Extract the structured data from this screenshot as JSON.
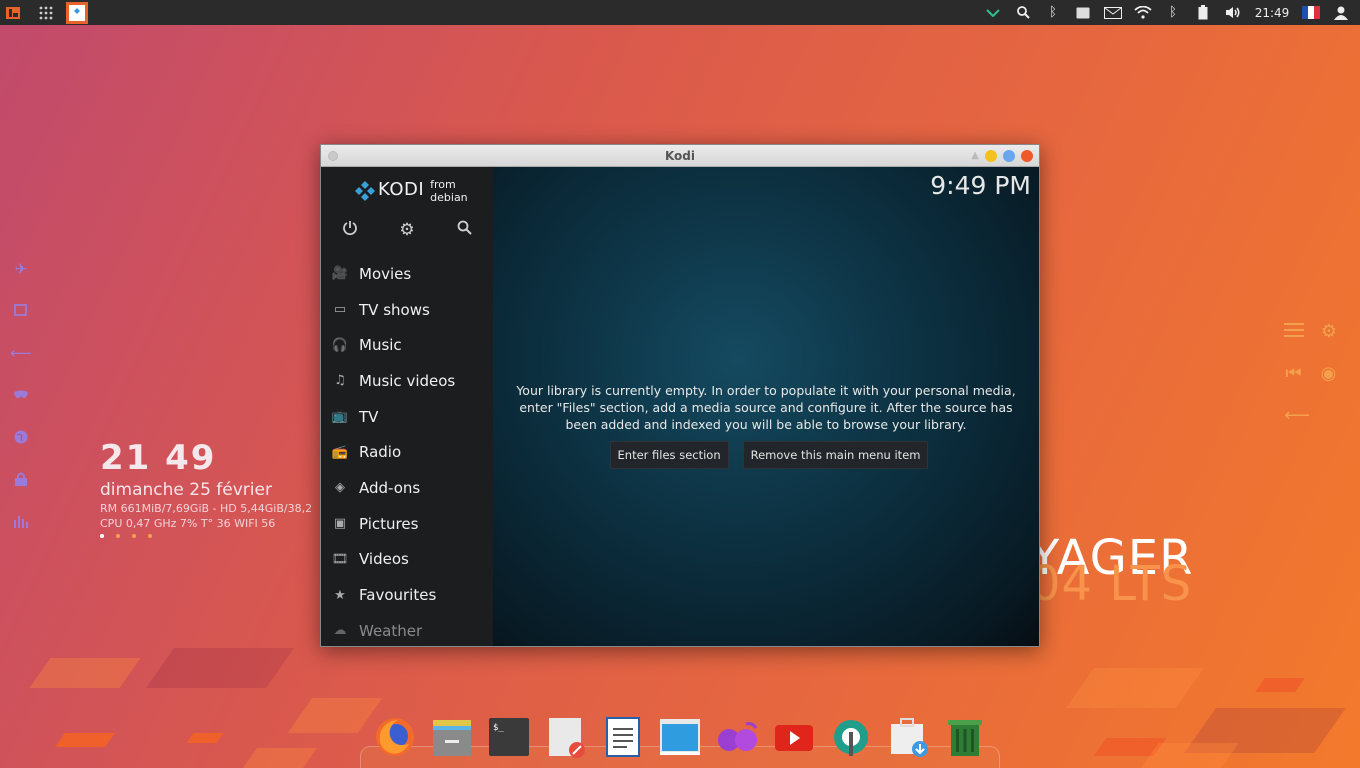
{
  "top_panel": {
    "clock": "21:49",
    "icons": [
      "app-menu-icon",
      "grid-apps-icon",
      "kodi-taskbar-icon",
      "chevron-down-icon",
      "search-icon",
      "bluetooth-icon",
      "tablet-icon",
      "mail-icon",
      "wifi-icon",
      "bluetooth-icon",
      "battery-icon",
      "volume-icon",
      "flag-fr-icon",
      "user-icon"
    ]
  },
  "widget": {
    "time": "21 49",
    "date": "dimanche 25 février",
    "stats_line1": "RM 661MiB/7,69GiB - HD 5,44GiB/38,2",
    "stats_line2": "CPU 0,47 GHz 7% T° 36  WIFI 56"
  },
  "brand": {
    "line1": "YAGER",
    "line2": "04 LTS"
  },
  "kodi": {
    "window_title": "Kodi",
    "logo_name": "KODI",
    "logo_sub": "from debian",
    "clock": "9:49 PM",
    "menu": [
      {
        "label": "Movies",
        "icon": "movies-icon"
      },
      {
        "label": "TV shows",
        "icon": "tv-shows-icon"
      },
      {
        "label": "Music",
        "icon": "music-icon"
      },
      {
        "label": "Music videos",
        "icon": "music-videos-icon"
      },
      {
        "label": "TV",
        "icon": "tv-icon"
      },
      {
        "label": "Radio",
        "icon": "radio-icon"
      },
      {
        "label": "Add-ons",
        "icon": "addons-icon"
      },
      {
        "label": "Pictures",
        "icon": "pictures-icon"
      },
      {
        "label": "Videos",
        "icon": "videos-icon"
      },
      {
        "label": "Favourites",
        "icon": "favourites-icon"
      },
      {
        "label": "Weather",
        "icon": "weather-icon"
      }
    ],
    "message": "Your library is currently empty. In order to populate it with your personal media, enter \"Files\" section, add a media source and configure it. After the source has been added and indexed you will be able to browse your library.",
    "btn_enter": "Enter files section",
    "btn_remove": "Remove this main menu item"
  },
  "dock": {
    "apps": [
      "firefox-icon",
      "file-manager-icon",
      "terminal-icon",
      "text-editor-icon",
      "writer-icon",
      "screenshot-icon",
      "podcast-icon",
      "youtube-icon",
      "settings-icon",
      "installer-icon",
      "trash-icon"
    ]
  },
  "colors": {
    "accent_purple": "#9b7bd9",
    "accent_orange": "#f3a14d",
    "panel": "#2b2b2b",
    "kodi_side": "#1c1d1f"
  }
}
